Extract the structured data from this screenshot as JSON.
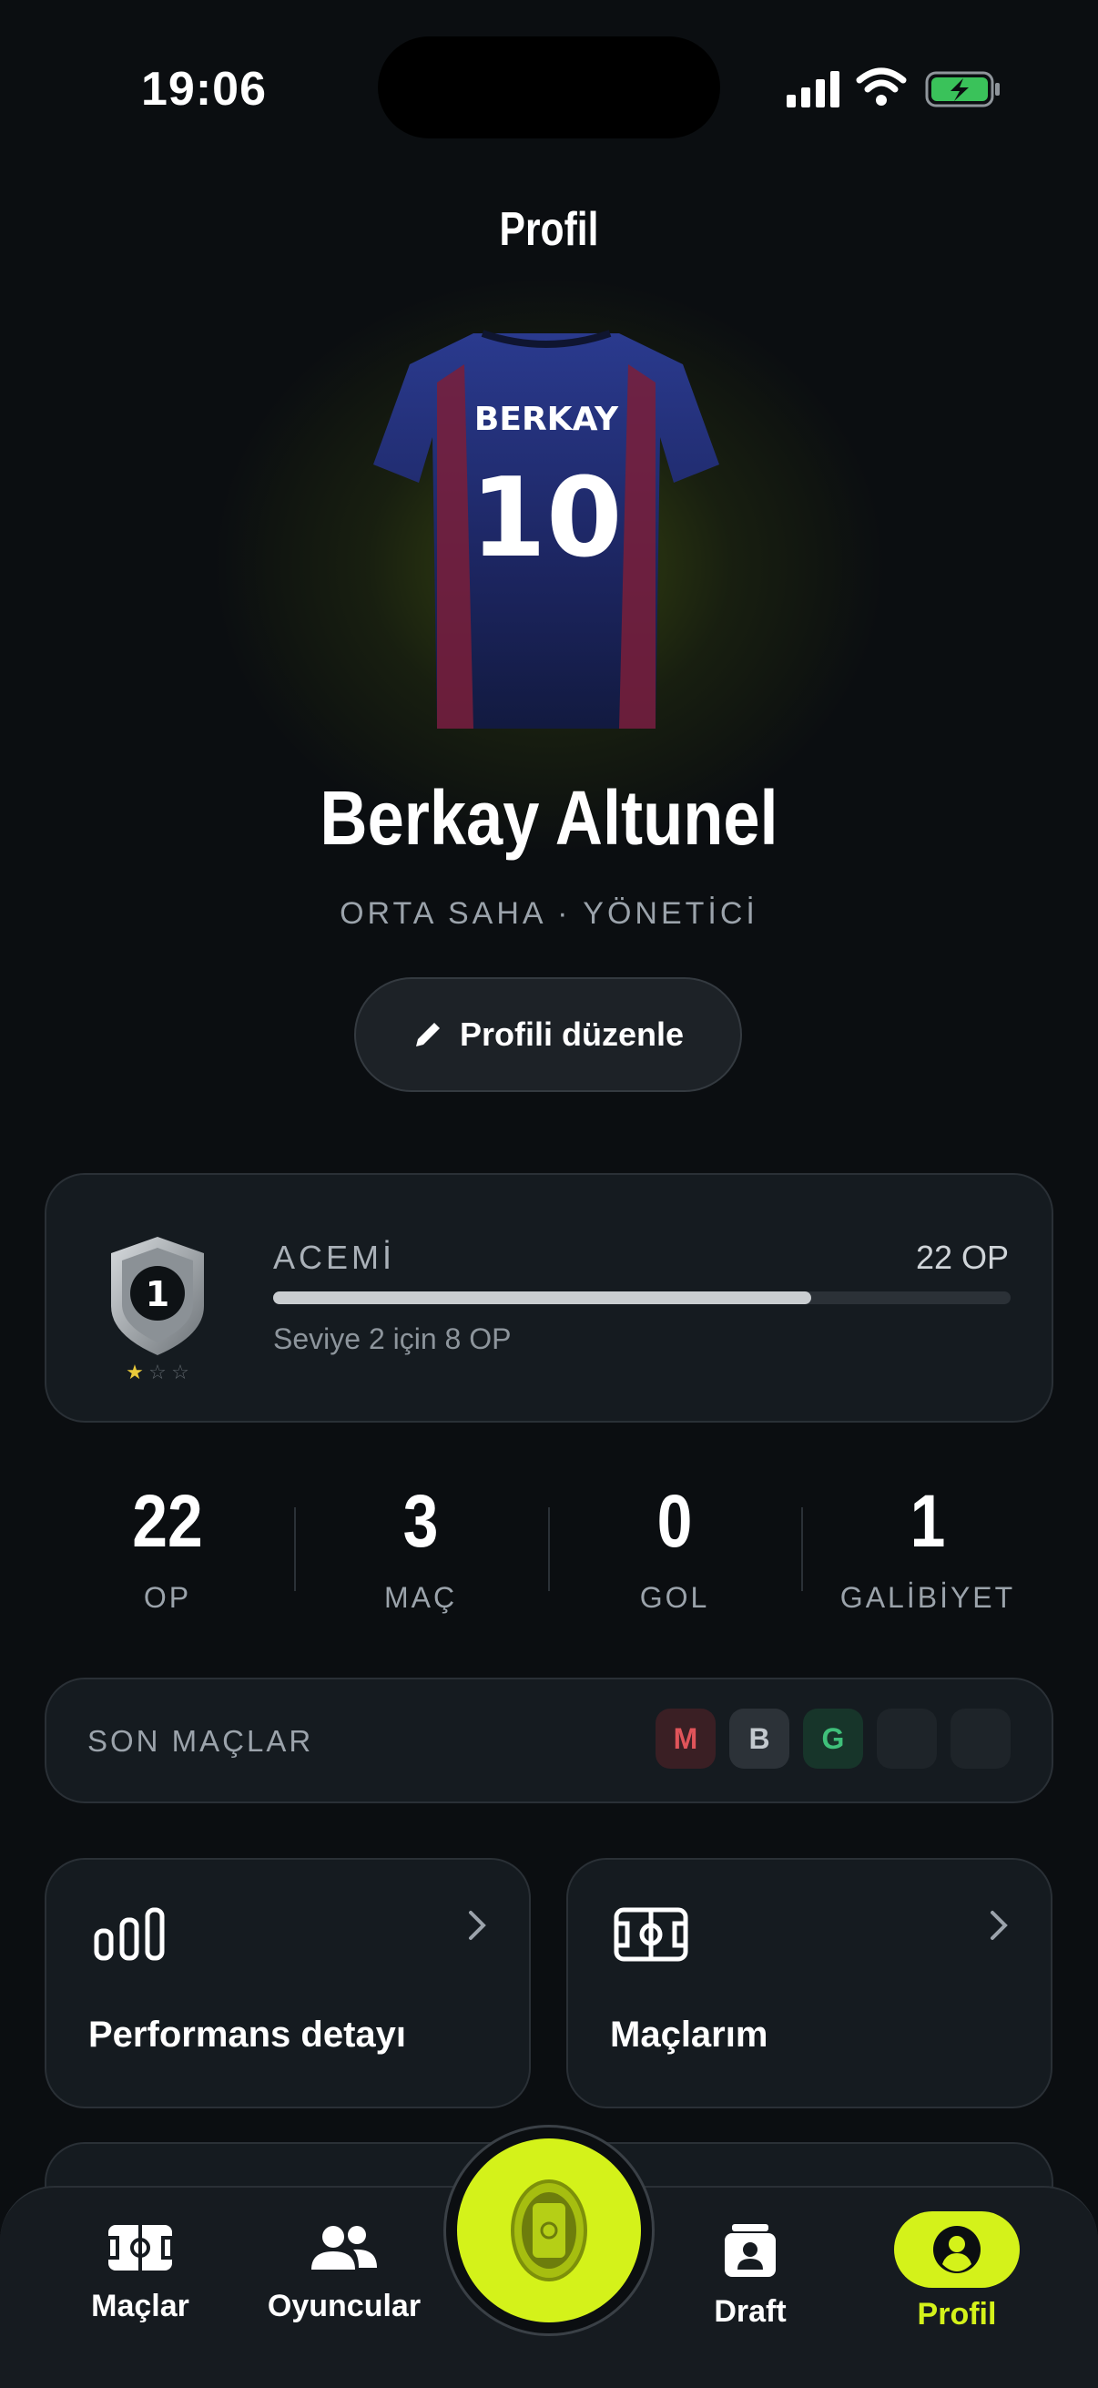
{
  "status_bar": {
    "time": "19:06"
  },
  "header": {
    "title": "Profil"
  },
  "jersey": {
    "name": "BERKAY",
    "number": "10"
  },
  "profile": {
    "name": "Berkay Altunel",
    "role": "ORTA SAHA · YÖNETİCİ",
    "edit_label": "Profili düzenle"
  },
  "level": {
    "badge_number": "1",
    "name": "ACEMİ",
    "points": "22 OP",
    "progress": 0.73,
    "next_text": "Seviye 2 için 8 OP"
  },
  "stats": [
    {
      "value": "22",
      "label": "OP"
    },
    {
      "value": "3",
      "label": "MAÇ"
    },
    {
      "value": "0",
      "label": "GOL"
    },
    {
      "value": "1",
      "label": "GALİBİYET"
    }
  ],
  "recent": {
    "label": "SON MAÇLAR",
    "results": [
      "M",
      "B",
      "G",
      "",
      ""
    ]
  },
  "tiles": [
    {
      "label": "Performans detayı",
      "icon": "bar-chart-icon"
    },
    {
      "label": "Maçlarım",
      "icon": "pitch-icon"
    }
  ],
  "tabs": [
    {
      "label": "Maçlar",
      "icon": "pitch-icon"
    },
    {
      "label": "Oyuncular",
      "icon": "users-icon"
    },
    {
      "label": "Draft",
      "icon": "id-card-icon"
    },
    {
      "label": "Profil",
      "icon": "user-circle-icon",
      "active": true
    }
  ],
  "colors": {
    "accent": "#d4f21a",
    "background": "#0b0e11",
    "card": "#151b20",
    "loss": "#e0545a",
    "win": "#3fc07a"
  }
}
